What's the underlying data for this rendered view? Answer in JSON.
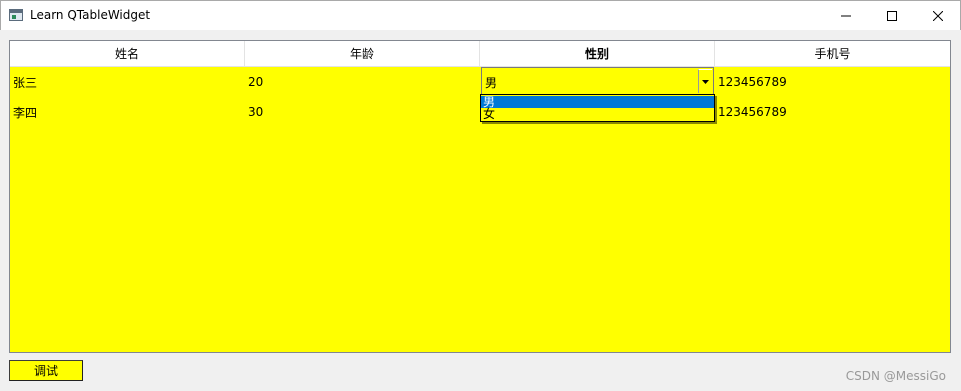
{
  "window": {
    "title": "Learn QTableWidget",
    "icon": "app-window-icon",
    "controls": [
      "minimize-icon",
      "maximize-icon",
      "close-icon"
    ]
  },
  "table": {
    "headers": [
      "姓名",
      "年龄",
      "性别",
      "手机号"
    ],
    "rows": [
      {
        "name": "张三",
        "age": "20",
        "gender": "男",
        "phone": "123456789"
      },
      {
        "name": "李四",
        "age": "30",
        "gender": "",
        "phone": "123456789"
      }
    ],
    "background": "#ffff00"
  },
  "combo": {
    "value": "男",
    "options": [
      "男",
      "女"
    ],
    "selected_index": 0,
    "highlight": "#0078d7"
  },
  "button": {
    "label": "调试"
  },
  "watermark": "CSDN @MessiGo"
}
